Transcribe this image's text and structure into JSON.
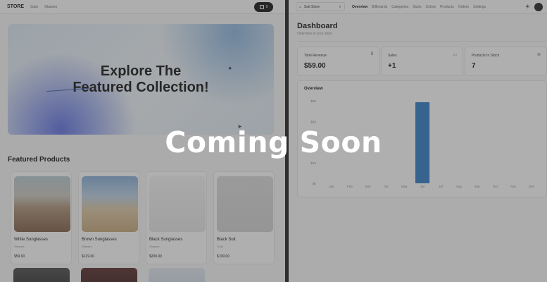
{
  "store": {
    "logo": "STORE",
    "nav": [
      "Suits",
      "Glasses"
    ],
    "cart_count": "0",
    "hero_title_line1": "Explore The",
    "hero_title_line2": "Featured Collection!",
    "section_title": "Featured Products",
    "products": [
      {
        "name": "White Sunglasses",
        "category": "Glasses",
        "price": "$59.00"
      },
      {
        "name": "Brown Sunglasses",
        "category": "Glasses",
        "price": "$129.00"
      },
      {
        "name": "Black Sunglasses",
        "category": "Glasses",
        "price": "$200.00"
      },
      {
        "name": "Black Suit",
        "category": "Suits",
        "price": "$199.00"
      }
    ]
  },
  "admin": {
    "store_switcher": "Suit Store",
    "nav": [
      "Overview",
      "Billboards",
      "Categories",
      "Sizes",
      "Colors",
      "Products",
      "Orders",
      "Settings"
    ],
    "active_nav": "Overview",
    "title": "Dashboard",
    "subtitle": "Overview of your store",
    "stats": [
      {
        "label": "Total Revenue",
        "value": "$59.00",
        "icon": "dollar-icon"
      },
      {
        "label": "Sales",
        "value": "+1",
        "icon": "credit-card-icon"
      },
      {
        "label": "Products In Stock",
        "value": "7",
        "icon": "package-icon"
      }
    ],
    "overview_title": "Overview"
  },
  "chart_data": {
    "type": "bar",
    "categories": [
      "Jan",
      "Feb",
      "Mar",
      "Apr",
      "May",
      "Jun",
      "Jul",
      "Aug",
      "Sep",
      "Oct",
      "Nov",
      "Dec"
    ],
    "values": [
      0,
      0,
      0,
      0,
      0,
      59,
      0,
      0,
      0,
      0,
      0,
      0
    ],
    "y_ticks": [
      "$0",
      "$15",
      "$30",
      "$45",
      "$60"
    ],
    "ylim": [
      0,
      60
    ],
    "bar_color": "#2d7bc4",
    "title": "",
    "xlabel": "",
    "ylabel": ""
  },
  "overlay": {
    "text": "Coming Soon"
  }
}
